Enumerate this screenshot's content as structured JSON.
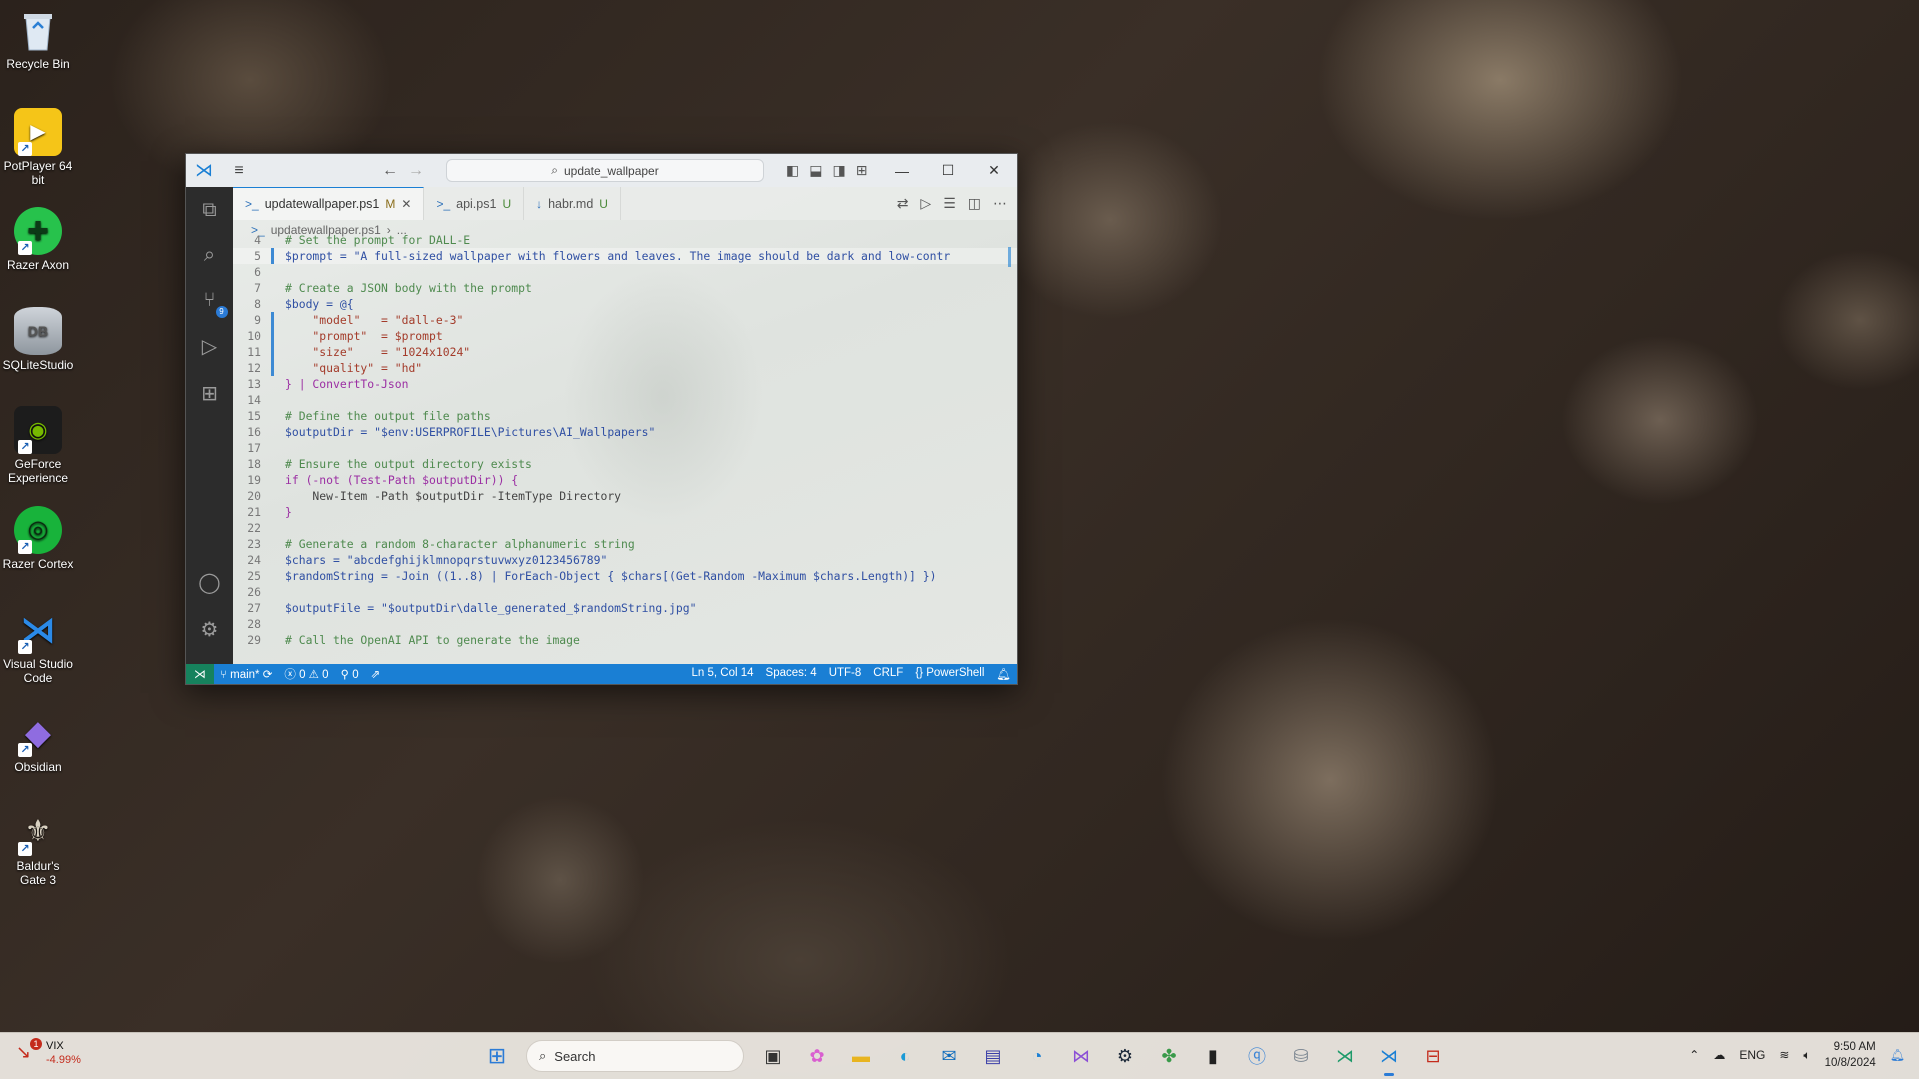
{
  "desktop": {
    "icons": [
      {
        "label": "Recycle Bin"
      },
      {
        "label": "PotPlayer 64 bit"
      },
      {
        "label": "Razer Axon"
      },
      {
        "label": "SQLiteStudio"
      },
      {
        "label": "GeForce Experience"
      },
      {
        "label": "Razer Cortex"
      },
      {
        "label": "Visual Studio Code"
      },
      {
        "label": "Obsidian"
      },
      {
        "label": "Baldur's Gate 3"
      }
    ]
  },
  "vscode": {
    "search_text": "update_wallpaper",
    "tabs": [
      {
        "label": "updatewallpaper.ps1",
        "status": "M"
      },
      {
        "label": "api.ps1",
        "status": "U"
      },
      {
        "label": "habr.md",
        "status": "U"
      }
    ],
    "breadcrumb": {
      "file": "updatewallpaper.ps1",
      "rest": "..."
    },
    "source_control_badge": "9",
    "code_lines": [
      {
        "n": "4",
        "t": "# Set the prompt for DALL-E"
      },
      {
        "n": "5",
        "t": "$prompt = \"A full-sized wallpaper with flowers and leaves. The image should be dark and low-contr"
      },
      {
        "n": "6",
        "t": ""
      },
      {
        "n": "7",
        "t": "# Create a JSON body with the prompt"
      },
      {
        "n": "8",
        "t": "$body = @{"
      },
      {
        "n": "9",
        "t": "    \"model\"   = \"dall-e-3\""
      },
      {
        "n": "10",
        "t": "    \"prompt\"  = $prompt"
      },
      {
        "n": "11",
        "t": "    \"size\"    = \"1024x1024\""
      },
      {
        "n": "12",
        "t": "    \"quality\" = \"hd\""
      },
      {
        "n": "13",
        "t": "} | ConvertTo-Json"
      },
      {
        "n": "14",
        "t": ""
      },
      {
        "n": "15",
        "t": "# Define the output file paths"
      },
      {
        "n": "16",
        "t": "$outputDir = \"$env:USERPROFILE\\Pictures\\AI_Wallpapers\""
      },
      {
        "n": "17",
        "t": ""
      },
      {
        "n": "18",
        "t": "# Ensure the output directory exists"
      },
      {
        "n": "19",
        "t": "if (-not (Test-Path $outputDir)) {"
      },
      {
        "n": "20",
        "t": "    New-Item -Path $outputDir -ItemType Directory"
      },
      {
        "n": "21",
        "t": "}"
      },
      {
        "n": "22",
        "t": ""
      },
      {
        "n": "23",
        "t": "# Generate a random 8-character alphanumeric string"
      },
      {
        "n": "24",
        "t": "$chars = \"abcdefghijklmnopqrstuvwxyz0123456789\""
      },
      {
        "n": "25",
        "t": "$randomString = -Join ((1..8) | ForEach-Object { $chars[(Get-Random -Maximum $chars.Length)] })"
      },
      {
        "n": "26",
        "t": ""
      },
      {
        "n": "27",
        "t": "$outputFile = \"$outputDir\\dalle_generated_$randomString.jpg\""
      },
      {
        "n": "28",
        "t": ""
      },
      {
        "n": "29",
        "t": "# Call the OpenAI API to generate the image"
      }
    ],
    "status": {
      "branch": "main*",
      "errors": "0",
      "warnings": "0",
      "ports": "0",
      "position": "Ln 5, Col 14",
      "spaces": "Spaces: 4",
      "encoding": "UTF-8",
      "eol": "CRLF",
      "language": "PowerShell"
    }
  },
  "taskbar": {
    "widget": {
      "symbol": "VIX",
      "change": "-4.99%",
      "notif": "1"
    },
    "search_placeholder": "Search",
    "lang": "ENG",
    "time": "9:50 AM",
    "date": "10/8/2024"
  },
  "colors": {
    "accent": "#1a7fd4",
    "status_remote": "#16825d"
  }
}
